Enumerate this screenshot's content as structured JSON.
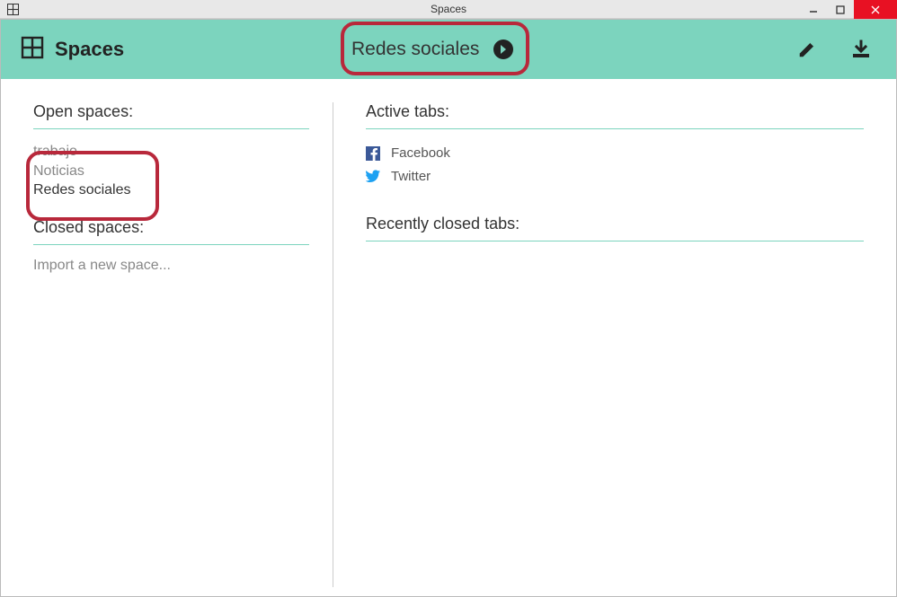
{
  "window": {
    "title": "Spaces"
  },
  "header": {
    "app_title": "Spaces",
    "current_space": "Redes sociales"
  },
  "sidebar": {
    "open_spaces_label": "Open spaces:",
    "open_spaces": [
      {
        "name": "trabajo",
        "active": false
      },
      {
        "name": "Noticias",
        "active": false
      },
      {
        "name": "Redes sociales",
        "active": true
      }
    ],
    "closed_spaces_label": "Closed spaces:",
    "import_label": "Import a new space..."
  },
  "main": {
    "active_tabs_label": "Active tabs:",
    "active_tabs": [
      {
        "name": "Facebook",
        "icon": "facebook"
      },
      {
        "name": "Twitter",
        "icon": "twitter"
      }
    ],
    "recently_closed_label": "Recently closed tabs:"
  },
  "colors": {
    "accent": "#7cd4be",
    "annotation": "#b8283b"
  }
}
